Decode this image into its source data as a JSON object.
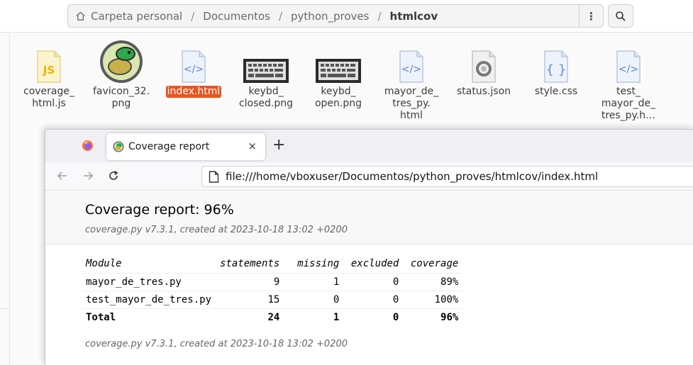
{
  "file_manager": {
    "breadcrumbs": [
      "Carpeta personal",
      "Documentos",
      "python_proves",
      "htmlcov"
    ],
    "menu_icon": "vertical-dots-icon",
    "search_icon": "search-icon",
    "files": [
      {
        "label": "coverage_\nhtml.js",
        "icon": "js-file-icon"
      },
      {
        "label": "favicon_32.\npng",
        "icon": "turtle-image-icon"
      },
      {
        "label": "index.html",
        "icon": "html-file-icon",
        "selected": true
      },
      {
        "label": "keybd_\nclosed.png",
        "icon": "keyboard-image-icon"
      },
      {
        "label": "keybd_\nopen.png",
        "icon": "keyboard-image-icon"
      },
      {
        "label": "mayor_de_\ntres_py.\nhtml",
        "icon": "html-file-icon"
      },
      {
        "label": "status.json",
        "icon": "json-file-icon"
      },
      {
        "label": "style.css",
        "icon": "css-file-icon"
      },
      {
        "label": "test_\nmayor_de_\ntres_py.h…",
        "icon": "html-file-icon"
      }
    ],
    "accent_color": "#e95420"
  },
  "browser": {
    "tab_title": "Coverage report",
    "tab_close": "×",
    "new_tab": "+",
    "url": "file:///home/vboxuser/Documentos/python_proves/htmlcov/index.html"
  },
  "report": {
    "title": "Coverage report: 96%",
    "meta": "coverage.py v7.3.1, created at 2023-10-18 13:02 +0200",
    "footer": "coverage.py v7.3.1, created at 2023-10-18 13:02 +0200",
    "columns": [
      "Module",
      "statements",
      "missing",
      "excluded",
      "coverage"
    ],
    "rows": [
      [
        "mayor_de_tres.py",
        "9",
        "1",
        "0",
        "89%"
      ],
      [
        "test_mayor_de_tres.py",
        "15",
        "0",
        "0",
        "100%"
      ]
    ],
    "total": [
      "Total",
      "24",
      "1",
      "0",
      "96%"
    ]
  }
}
